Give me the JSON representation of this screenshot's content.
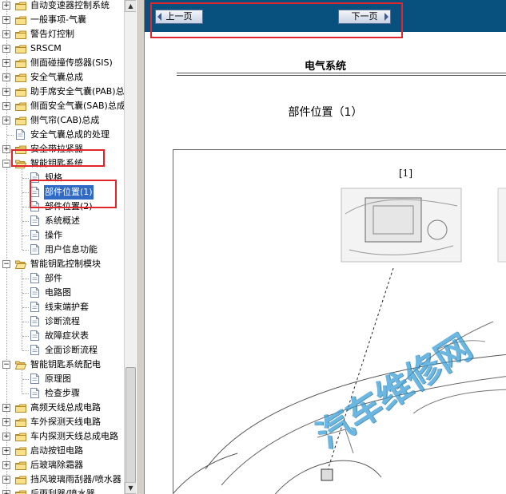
{
  "tree": {
    "items": [
      {
        "label": "自动变速器控制系统",
        "type": "folder",
        "level": 0,
        "expanded": false
      },
      {
        "label": "一般事项-气囊",
        "type": "folder",
        "level": 0,
        "expanded": false
      },
      {
        "label": "警告灯控制",
        "type": "folder",
        "level": 0,
        "expanded": false
      },
      {
        "label": "SRSCM",
        "type": "folder",
        "level": 0,
        "expanded": false
      },
      {
        "label": "侧面碰撞传感器(SIS)",
        "type": "folder",
        "level": 0,
        "expanded": false
      },
      {
        "label": "安全气囊总成",
        "type": "folder",
        "level": 0,
        "expanded": false
      },
      {
        "label": "助手席安全气囊(PAB)总成",
        "type": "folder",
        "level": 0,
        "expanded": false
      },
      {
        "label": "侧面安全气囊(SAB)总成",
        "type": "folder",
        "level": 0,
        "expanded": false
      },
      {
        "label": "侧气帘(CAB)总成",
        "type": "folder",
        "level": 0,
        "expanded": false
      },
      {
        "label": "安全气囊总成的处理",
        "type": "page",
        "level": 0
      },
      {
        "label": "安全带拉紧器",
        "type": "folder",
        "level": 0,
        "expanded": false
      },
      {
        "label": "智能钥匙系统",
        "type": "folder",
        "level": 0,
        "expanded": true
      },
      {
        "label": "规格",
        "type": "page",
        "level": 1
      },
      {
        "label": "部件位置(1)",
        "type": "page",
        "level": 1,
        "selected": true
      },
      {
        "label": "部件位置(2)",
        "type": "page",
        "level": 1
      },
      {
        "label": "系统概述",
        "type": "page",
        "level": 1
      },
      {
        "label": "操作",
        "type": "page",
        "level": 1
      },
      {
        "label": "用户信息功能",
        "type": "page",
        "level": 1
      },
      {
        "label": "智能钥匙控制模块",
        "type": "folder",
        "level": 0,
        "expanded": true
      },
      {
        "label": "部件",
        "type": "page",
        "level": 1
      },
      {
        "label": "电路图",
        "type": "page",
        "level": 1
      },
      {
        "label": "线束端护套",
        "type": "page",
        "level": 1
      },
      {
        "label": "诊断流程",
        "type": "page",
        "level": 1
      },
      {
        "label": "故障症状表",
        "type": "page",
        "level": 1
      },
      {
        "label": "全面诊断流程",
        "type": "page",
        "level": 1
      },
      {
        "label": "智能钥匙系统配电",
        "type": "folder",
        "level": 0,
        "expanded": true
      },
      {
        "label": "原理图",
        "type": "page",
        "level": 1
      },
      {
        "label": "检查步骤",
        "type": "page",
        "level": 1
      },
      {
        "label": "高频天线总成电路",
        "type": "folder",
        "level": 0,
        "expanded": false
      },
      {
        "label": "车外探测天线电路",
        "type": "folder",
        "level": 0,
        "expanded": false
      },
      {
        "label": "车内探测天线总成电路",
        "type": "folder",
        "level": 0,
        "expanded": false
      },
      {
        "label": "启动按钮电路",
        "type": "folder",
        "level": 0,
        "expanded": false
      },
      {
        "label": "后玻璃除霜器",
        "type": "folder",
        "level": 0,
        "expanded": false
      },
      {
        "label": "挡风玻璃雨刮器/喷水器",
        "type": "folder",
        "level": 0,
        "expanded": false
      },
      {
        "label": "后雨刮器/喷水器",
        "type": "folder",
        "level": 0,
        "expanded": false
      }
    ]
  },
  "nav": {
    "prev_label": "上一页",
    "next_label": "下一页"
  },
  "doc": {
    "heading": "电气系统",
    "subheading": "部件位置（1）",
    "figure_label": "[1]",
    "watermark": "汽车维修网"
  },
  "colors": {
    "nav_bar": "#08507e",
    "highlight_box": "#e0262c",
    "selection": "#316ac5",
    "watermark": "#3aa0d8"
  }
}
